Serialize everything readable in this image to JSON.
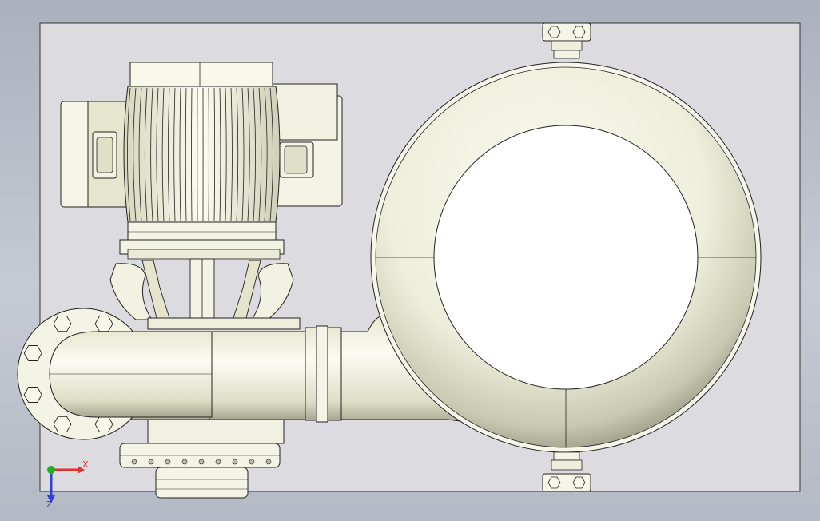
{
  "app": {
    "background_top": "#aab1bd",
    "background_bottom": "#b4bac5",
    "sheet_fill": "#dcdce0",
    "part_fill": "#f7f7e9",
    "line_color": "#222222"
  },
  "triad": {
    "x_label": "X",
    "z_label": "Z",
    "x_color": "#e03030",
    "y_color": "#20b020",
    "z_color": "#3040d0"
  }
}
